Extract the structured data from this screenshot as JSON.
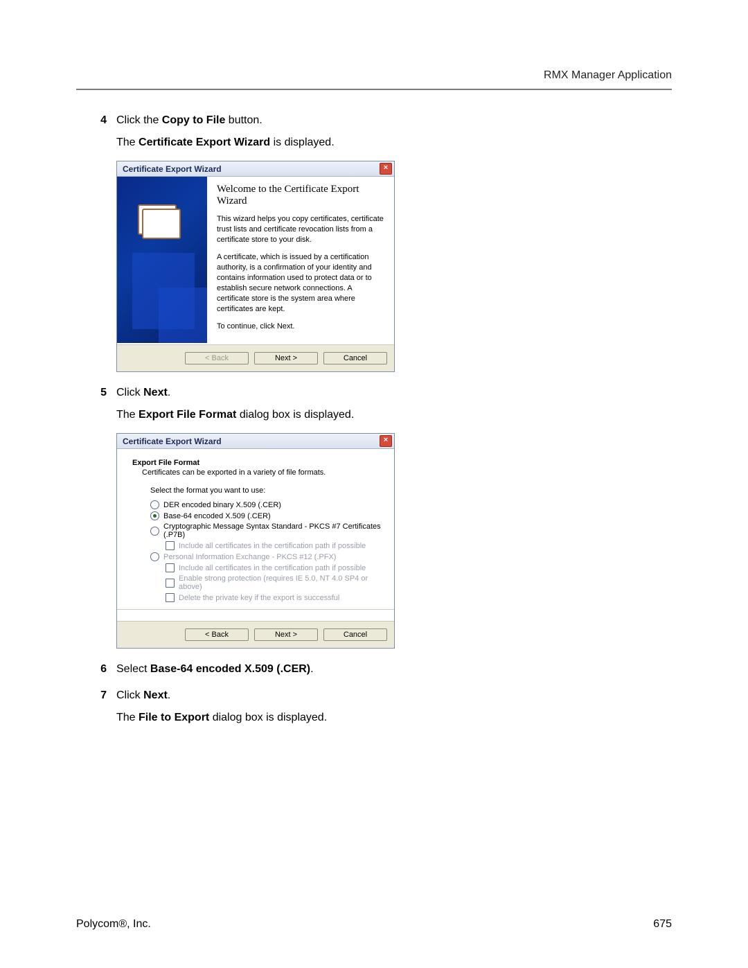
{
  "header": {
    "running_head": "RMX Manager Application"
  },
  "steps": {
    "s4": {
      "num": "4",
      "line1_a": "Click the ",
      "line1_bold": "Copy to File",
      "line1_b": " button.",
      "line2_a": "The ",
      "line2_bold": "Certificate Export Wizard",
      "line2_b": " is displayed."
    },
    "s5": {
      "num": "5",
      "line1_a": "Click ",
      "line1_bold": "Next",
      "line1_b": ".",
      "line2_a": "The ",
      "line2_bold": "Export File Format",
      "line2_b": " dialog box is displayed."
    },
    "s6": {
      "num": "6",
      "line1_a": "Select ",
      "line1_bold": "Base-64 encoded X.509 (.CER)",
      "line1_b": "."
    },
    "s7": {
      "num": "7",
      "line1_a": "Click ",
      "line1_bold": "Next",
      "line1_b": ".",
      "line2_a": "The ",
      "line2_bold": "File to Export",
      "line2_b": " dialog box is displayed."
    }
  },
  "wizard1": {
    "title": "Certificate Export Wizard",
    "heading": "Welcome to the Certificate Export Wizard",
    "p1": "This wizard helps you copy certificates, certificate trust lists and certificate revocation lists from a certificate store to your disk.",
    "p2": "A certificate, which is issued by a certification authority, is a confirmation of your identity and contains information used to protect data or to establish secure network connections. A certificate store is the system area where certificates are kept.",
    "p3": "To continue, click Next.",
    "buttons": {
      "back": "< Back",
      "next": "Next >",
      "cancel": "Cancel"
    }
  },
  "wizard2": {
    "title": "Certificate Export Wizard",
    "header": "Export File Format",
    "sub": "Certificates can be exported in a variety of file formats.",
    "prompt": "Select the format you want to use:",
    "options": {
      "der": "DER encoded binary X.509 (.CER)",
      "base64": "Base-64 encoded X.509 (.CER)",
      "p7b": "Cryptographic Message Syntax Standard - PKCS #7 Certificates (.P7B)",
      "p7b_chk": "Include all certificates in the certification path if possible",
      "pfx": "Personal Information Exchange - PKCS #12 (.PFX)",
      "pfx_c1": "Include all certificates in the certification path if possible",
      "pfx_c2": "Enable strong protection (requires IE 5.0, NT 4.0 SP4 or above)",
      "pfx_c3": "Delete the private key if the export is successful"
    },
    "buttons": {
      "back": "< Back",
      "next": "Next >",
      "cancel": "Cancel"
    }
  },
  "footer": {
    "left": "Polycom®, Inc.",
    "right": "675"
  }
}
